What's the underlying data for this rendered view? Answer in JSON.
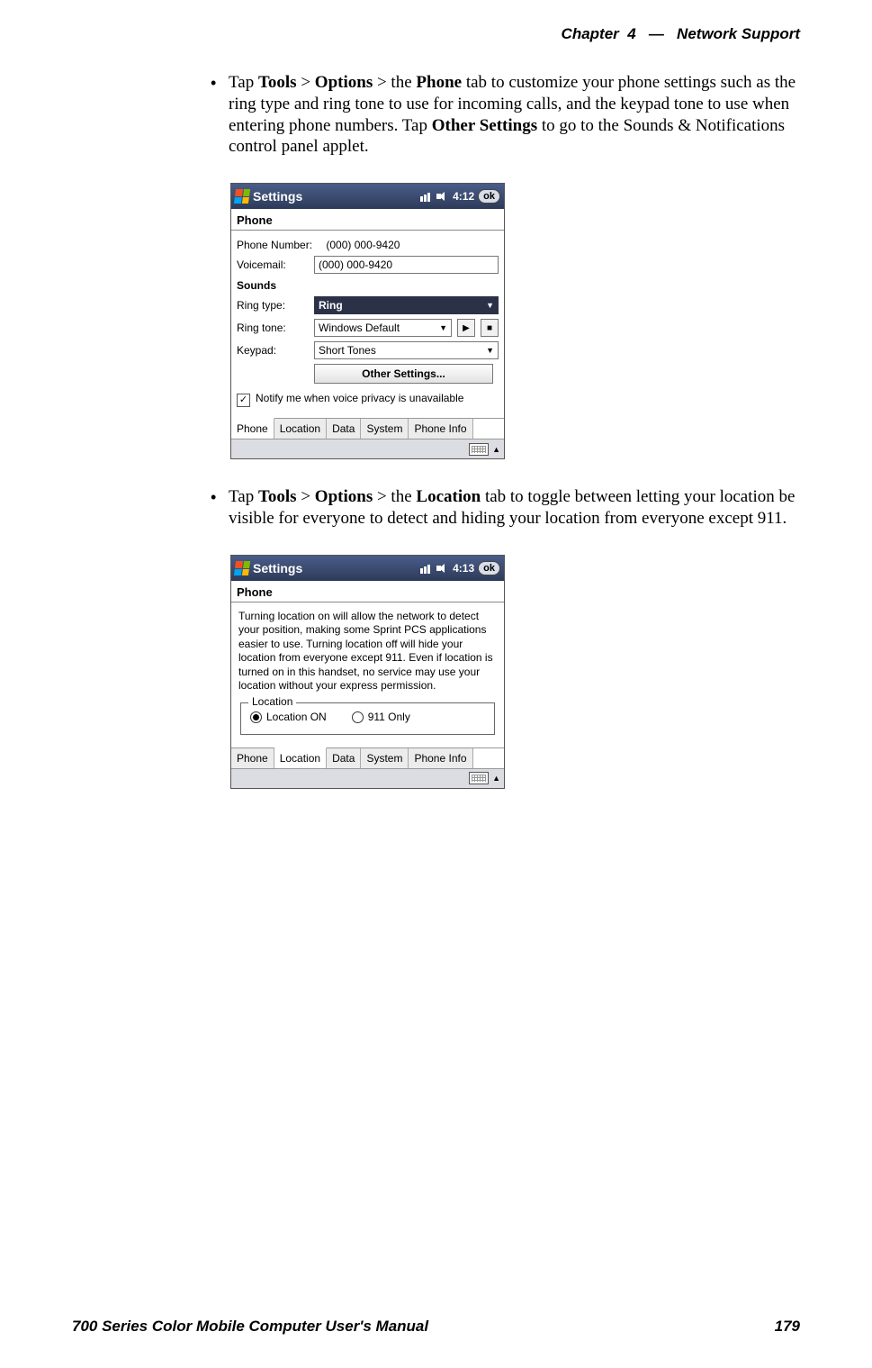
{
  "header": {
    "chapter_label": "Chapter",
    "chapter_num": "4",
    "sep": "—",
    "title": "Network Support"
  },
  "para1": {
    "pre": "Tap ",
    "b1": "Tools",
    "gt1": " > ",
    "b2": "Options",
    "gt2": " > the ",
    "b3": "Phone",
    "mid": " tab to customize your phone settings such as the ring type and ring tone to use for incoming calls, and the keypad tone to use when entering phone numbers. Tap ",
    "b4": "Other Settings",
    "end": " to go to the Sounds & Notifications control panel applet."
  },
  "shot1": {
    "settings": "Settings",
    "time": "4:12",
    "ok": "ok",
    "heading": "Phone",
    "phoneNumberLabel": "Phone Number:",
    "phoneNumber": "(000) 000-9420",
    "voicemailLabel": "Voicemail:",
    "voicemail": "(000) 000-9420",
    "soundsLabel": "Sounds",
    "ringTypeLabel": "Ring type:",
    "ringType": "Ring",
    "ringToneLabel": "Ring tone:",
    "ringTone": "Windows Default",
    "keypadLabel": "Keypad:",
    "keypad": "Short Tones",
    "otherSettings": "Other Settings...",
    "notify": "Notify me when voice privacy is unavailable",
    "tabs": [
      "Phone",
      "Location",
      "Data",
      "System",
      "Phone Info"
    ],
    "activeTab": 0
  },
  "para2": {
    "pre": "Tap ",
    "b1": "Tools",
    "gt1": " > ",
    "b2": "Options",
    "gt2": " > the ",
    "b3": "Location",
    "end": " tab to toggle between letting your location be visible for everyone to detect and hiding your location from everyone except 911."
  },
  "shot2": {
    "settings": "Settings",
    "time": "4:13",
    "ok": "ok",
    "heading": "Phone",
    "body": "Turning location on will allow the network to detect your position, making some Sprint PCS applications easier to use.  Turning location off will hide your location from everyone except 911.  Even if location is turned on in this handset, no service may use your location without your express permission.",
    "legend": "Location",
    "opt1": "Location ON",
    "opt2": "911 Only",
    "tabs": [
      "Phone",
      "Location",
      "Data",
      "System",
      "Phone Info"
    ],
    "activeTab": 1
  },
  "footer": {
    "left": "700 Series Color Mobile Computer User's Manual",
    "right": "179"
  }
}
